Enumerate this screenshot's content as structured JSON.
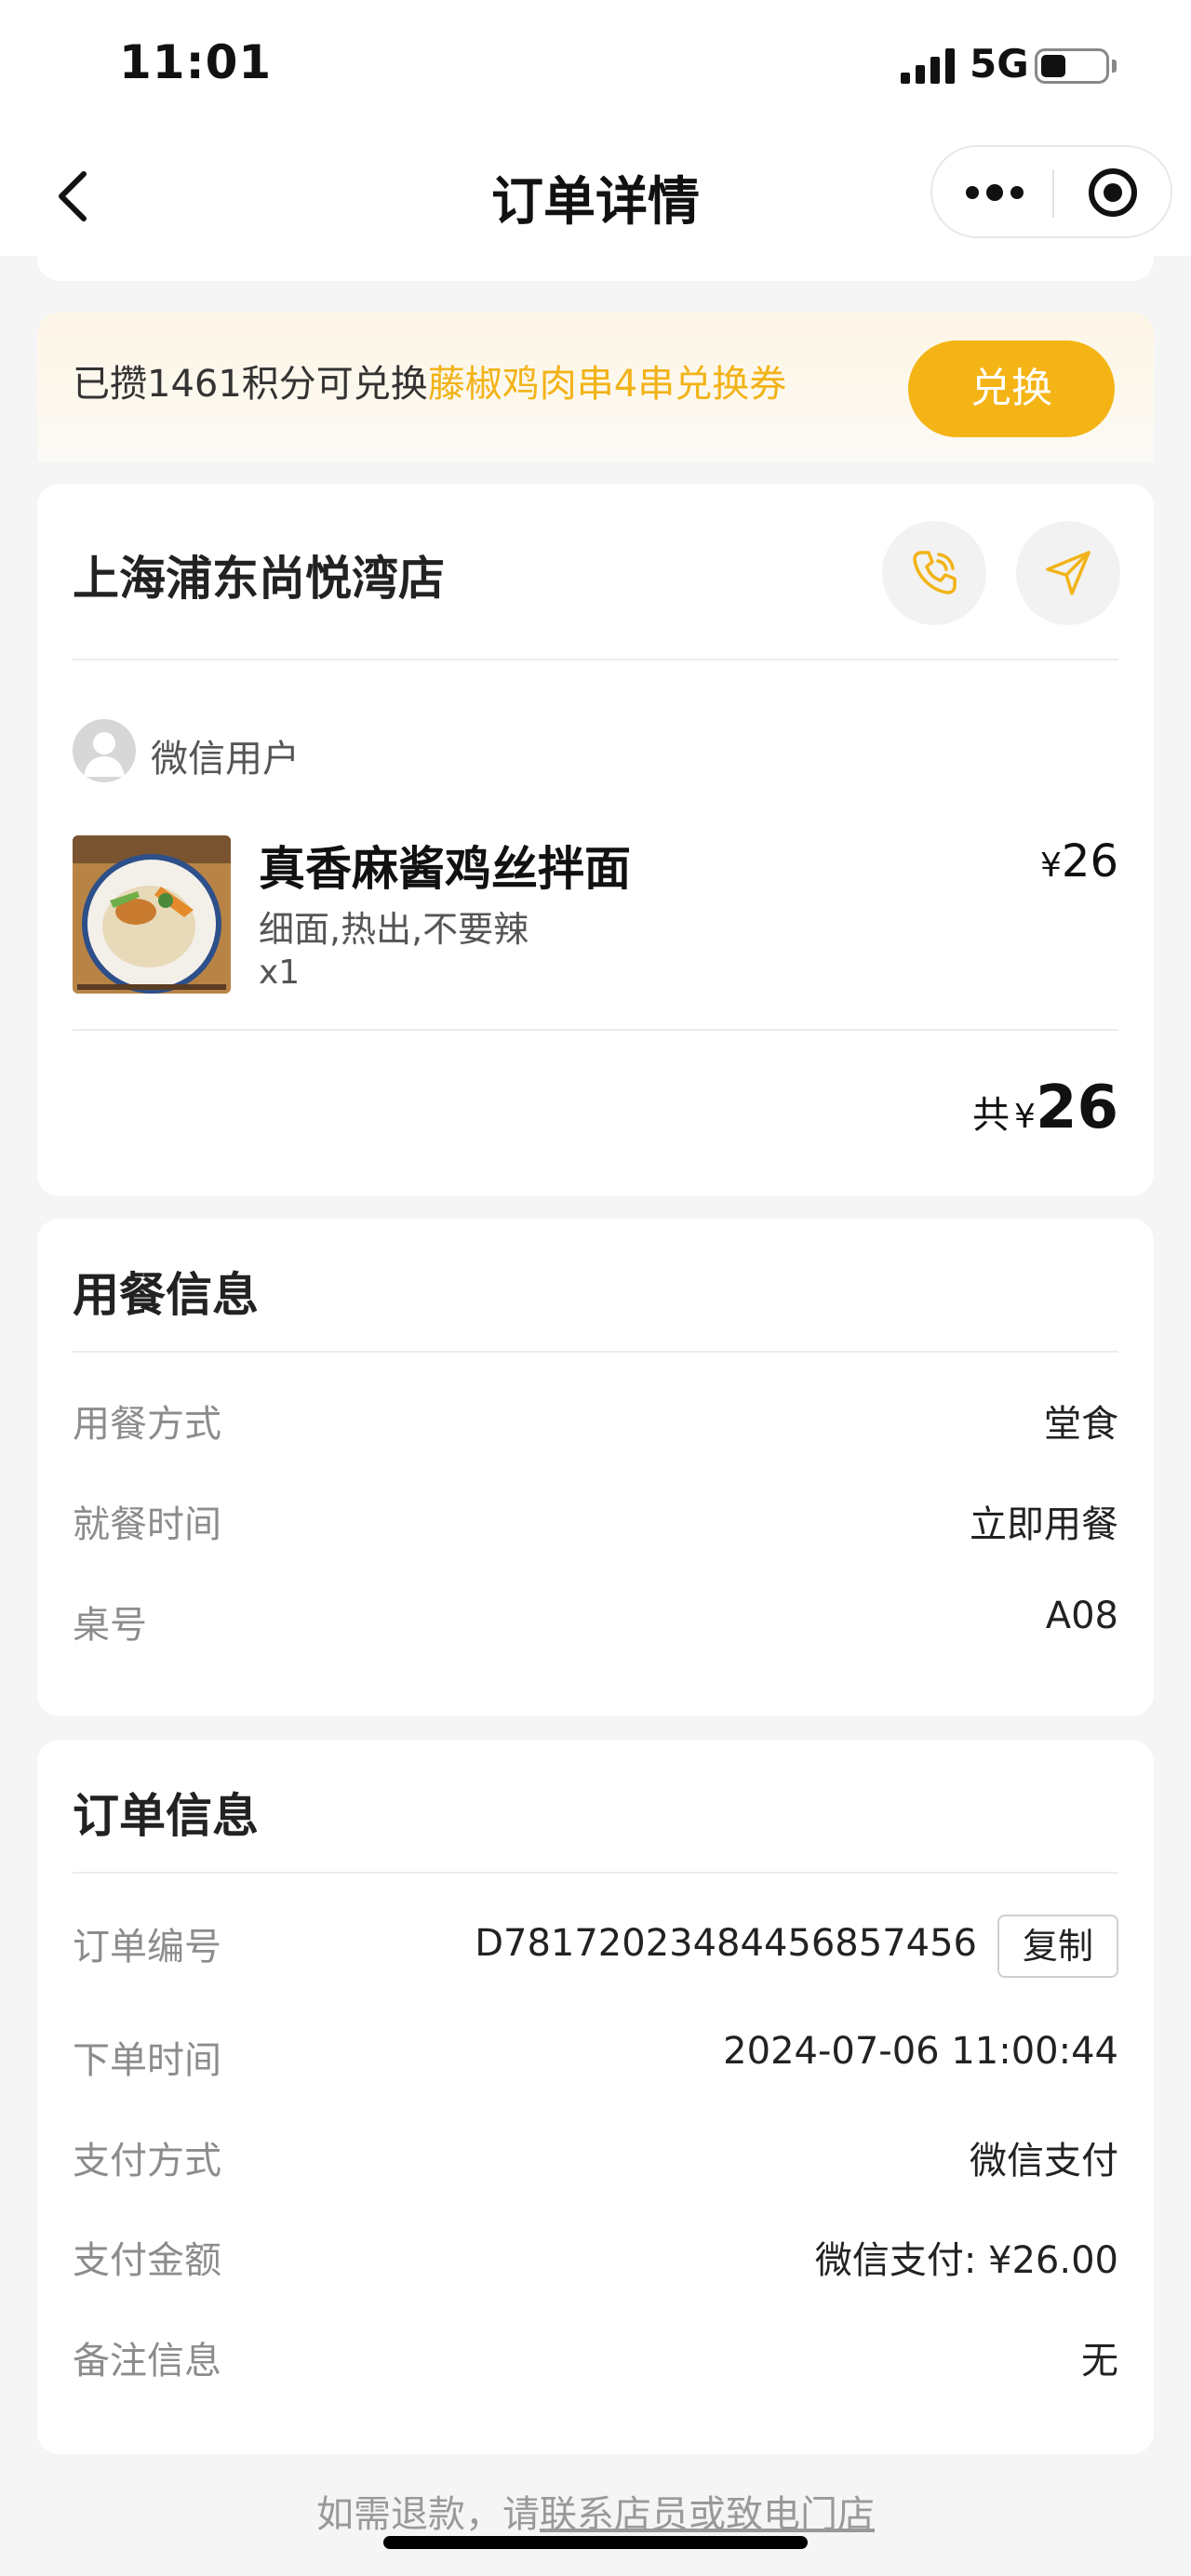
{
  "status_bar": {
    "time": "11:01",
    "network": "5G"
  },
  "nav": {
    "title": "订单详情",
    "icons": {
      "back": "chevron-left-icon",
      "more": "more-dots-icon",
      "close": "target-icon"
    }
  },
  "points": {
    "prefix": "已攒1461积分可兑换",
    "highlight": "藤椒鸡肉串4串兑换券",
    "button": "兑换",
    "accent_color": "#f5b416"
  },
  "store": {
    "name": "上海浦东尚悦湾店",
    "icons": {
      "phone": "phone-icon",
      "navigate": "navigation-arrow-icon"
    },
    "user": {
      "name": "微信用户"
    },
    "items": [
      {
        "name": "真香麻酱鸡丝拌面",
        "currency": "¥",
        "price": "26",
        "spec": "细面,热出,不要辣",
        "qty": "x1"
      }
    ],
    "total": {
      "label": "共",
      "currency": "¥",
      "amount": "26"
    }
  },
  "meal_info": {
    "title": "用餐信息",
    "rows": [
      {
        "label": "用餐方式",
        "value": "堂食"
      },
      {
        "label": "就餐时间",
        "value": "立即用餐"
      },
      {
        "label": "桌号",
        "value": "A08"
      }
    ]
  },
  "order_info": {
    "title": "订单信息",
    "order_no": {
      "label": "订单编号",
      "value": "D78172023484456857456",
      "copy": "复制"
    },
    "rows": [
      {
        "label": "下单时间",
        "value": "2024-07-06 11:00:44"
      },
      {
        "label": "支付方式",
        "value": "微信支付"
      },
      {
        "label": "支付金额",
        "value": "微信支付: ¥26.00"
      },
      {
        "label": "备注信息",
        "value": "无"
      }
    ]
  },
  "footer": {
    "prefix": "如需退款，请",
    "link": "联系店员或致电门店"
  }
}
